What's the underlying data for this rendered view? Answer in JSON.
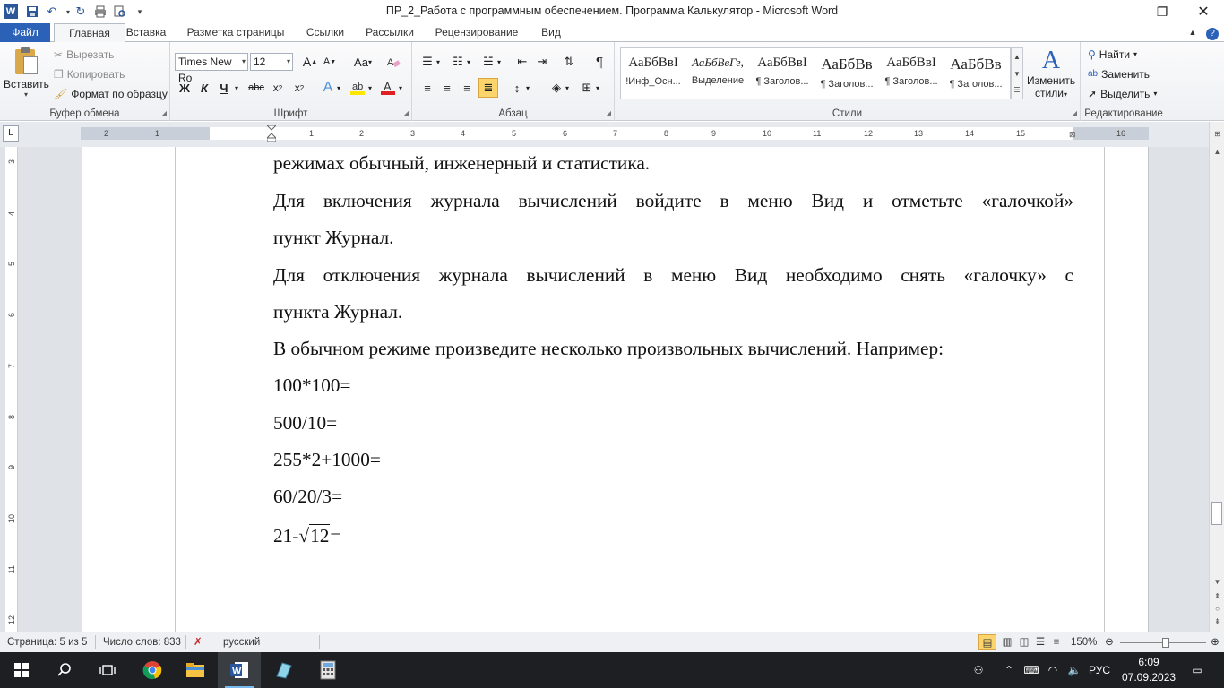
{
  "window": {
    "title": "ПР_2_Работа с программным обеспечением. Программа Калькулятор  -  Microsoft Word",
    "app_icon": "W"
  },
  "ribbon_tabs": [
    "Файл",
    "Главная",
    "Вставка",
    "Разметка страницы",
    "Ссылки",
    "Рассылки",
    "Рецензирование",
    "Вид"
  ],
  "clipboard": {
    "paste": "Вставить",
    "cut": "Вырезать",
    "copy": "Копировать",
    "format_painter": "Формат по образцу",
    "label": "Буфер обмена"
  },
  "font": {
    "name": "Times New Ro",
    "size": "12",
    "label": "Шрифт",
    "bold": "Ж",
    "italic": "К",
    "underline": "Ч",
    "strike": "abc",
    "grow": "A",
    "shrink": "A",
    "case": "Aa"
  },
  "paragraph": {
    "label": "Абзац"
  },
  "styles": {
    "label": "Стили",
    "items": [
      {
        "sample": "АаБбВвI",
        "name": "!Инф_Осн..."
      },
      {
        "sample": "АаБбВвГг,",
        "name": "Выделение"
      },
      {
        "sample": "АаБбВвI",
        "name": "¶ Заголов..."
      },
      {
        "sample": "АаБбВв",
        "name": "¶ Заголов..."
      },
      {
        "sample": "АаБбВвI",
        "name": "¶ Заголов..."
      },
      {
        "sample": "АаБбВв",
        "name": "¶ Заголов..."
      }
    ],
    "change_styles_1": "Изменить",
    "change_styles_2": "стили"
  },
  "editing": {
    "find": "Найти",
    "replace": "Заменить",
    "select": "Выделить",
    "label": "Редактирование"
  },
  "ruler": {
    "h_numbers": [
      "2",
      "1",
      "1",
      "2",
      "3",
      "4",
      "5",
      "6",
      "7",
      "8",
      "9",
      "10",
      "11",
      "12",
      "13",
      "14",
      "15",
      "16",
      "18"
    ],
    "v_numbers": [
      "3",
      "4",
      "5",
      "6",
      "7",
      "8",
      "9",
      "10",
      "11",
      "12"
    ]
  },
  "document": {
    "lines": [
      "режимах обычный, инженерный и статистика.",
      "Для включения журнала вычислений войдите в меню Вид и отметьте «галочкой»",
      "пункт Журнал.",
      "Для отключения журнала вычислений в меню Вид необходимо снять «галочку» с",
      "пункта Журнал.",
      "В обычном режиме произведите несколько произвольных вычислений. Например:",
      "100*100=",
      "500/10=",
      "255*2+1000=",
      "60/20/3="
    ],
    "sqrt_expr_prefix": "21-",
    "sqrt_radicand": "12",
    "sqrt_expr_suffix": "="
  },
  "status": {
    "page": "Страница: 5 из 5",
    "words": "Число слов: 833",
    "language": "русский",
    "zoom": "150%"
  },
  "taskbar": {
    "lang": "РУС",
    "time": "6:09",
    "date": "07.09.2023"
  }
}
